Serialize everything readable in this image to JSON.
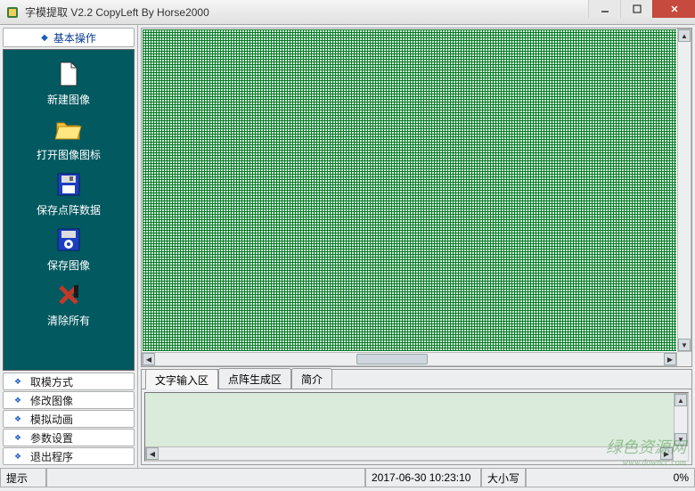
{
  "window": {
    "title": "字模提取 V2.2  CopyLeft By Horse2000"
  },
  "sidebar": {
    "header": "基本操作",
    "items": [
      {
        "label": "新建图像"
      },
      {
        "label": "打开图像图标"
      },
      {
        "label": "保存点阵数据"
      },
      {
        "label": "保存图像"
      },
      {
        "label": "清除所有"
      }
    ],
    "footer": [
      {
        "label": "取模方式"
      },
      {
        "label": "修改图像"
      },
      {
        "label": "模拟动画"
      },
      {
        "label": "参数设置"
      },
      {
        "label": "退出程序"
      }
    ]
  },
  "tabs": [
    {
      "label": "文字输入区"
    },
    {
      "label": "点阵生成区"
    },
    {
      "label": "简介"
    }
  ],
  "statusbar": {
    "tip": "提示",
    "timestamp": "2017-06-30 10:23:10",
    "caps": "大小写",
    "progress": "0%"
  },
  "watermark": {
    "main": "绿色资源网",
    "sub": "www.downcc.com"
  }
}
